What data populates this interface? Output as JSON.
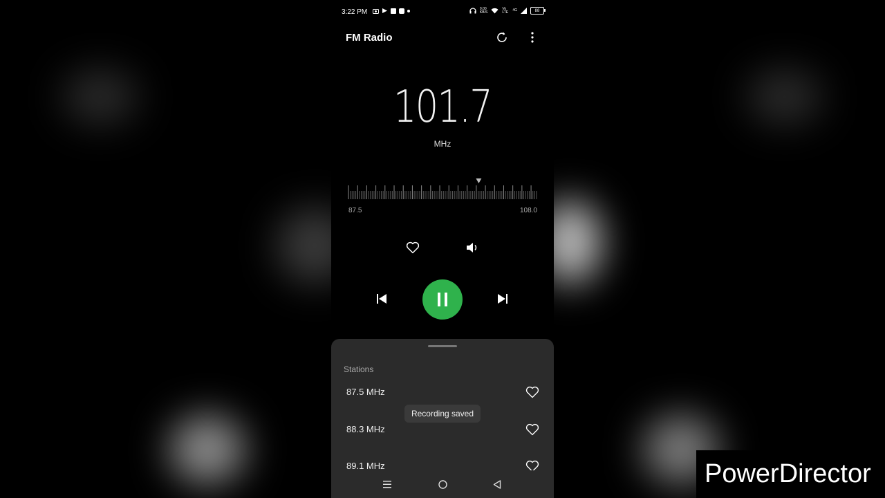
{
  "status_bar": {
    "time": "3:22 PM",
    "net_speed": "0.00",
    "net_unit": "KB/S",
    "volte": "Vo LTE",
    "network": "4G",
    "battery": "88"
  },
  "app": {
    "title": "FM Radio",
    "refresh_icon": "refresh-icon",
    "menu_icon": "more-vert-icon"
  },
  "tuner": {
    "frequency": "101.7",
    "unit": "MHz",
    "range_min": "87.5",
    "range_max": "108.0"
  },
  "controls": {
    "favorite_icon": "heart-outline-icon",
    "speaker_icon": "speaker-icon",
    "prev_icon": "skip-previous-icon",
    "play_state_icon": "pause-icon",
    "next_icon": "skip-next-icon",
    "accent": "#2fb24c"
  },
  "stations": {
    "title": "Stations",
    "items": [
      {
        "label": "87.5 MHz"
      },
      {
        "label": "88.3 MHz"
      },
      {
        "label": "89.1 MHz"
      }
    ]
  },
  "toast": "Recording saved",
  "watermark": "PowerDirector"
}
